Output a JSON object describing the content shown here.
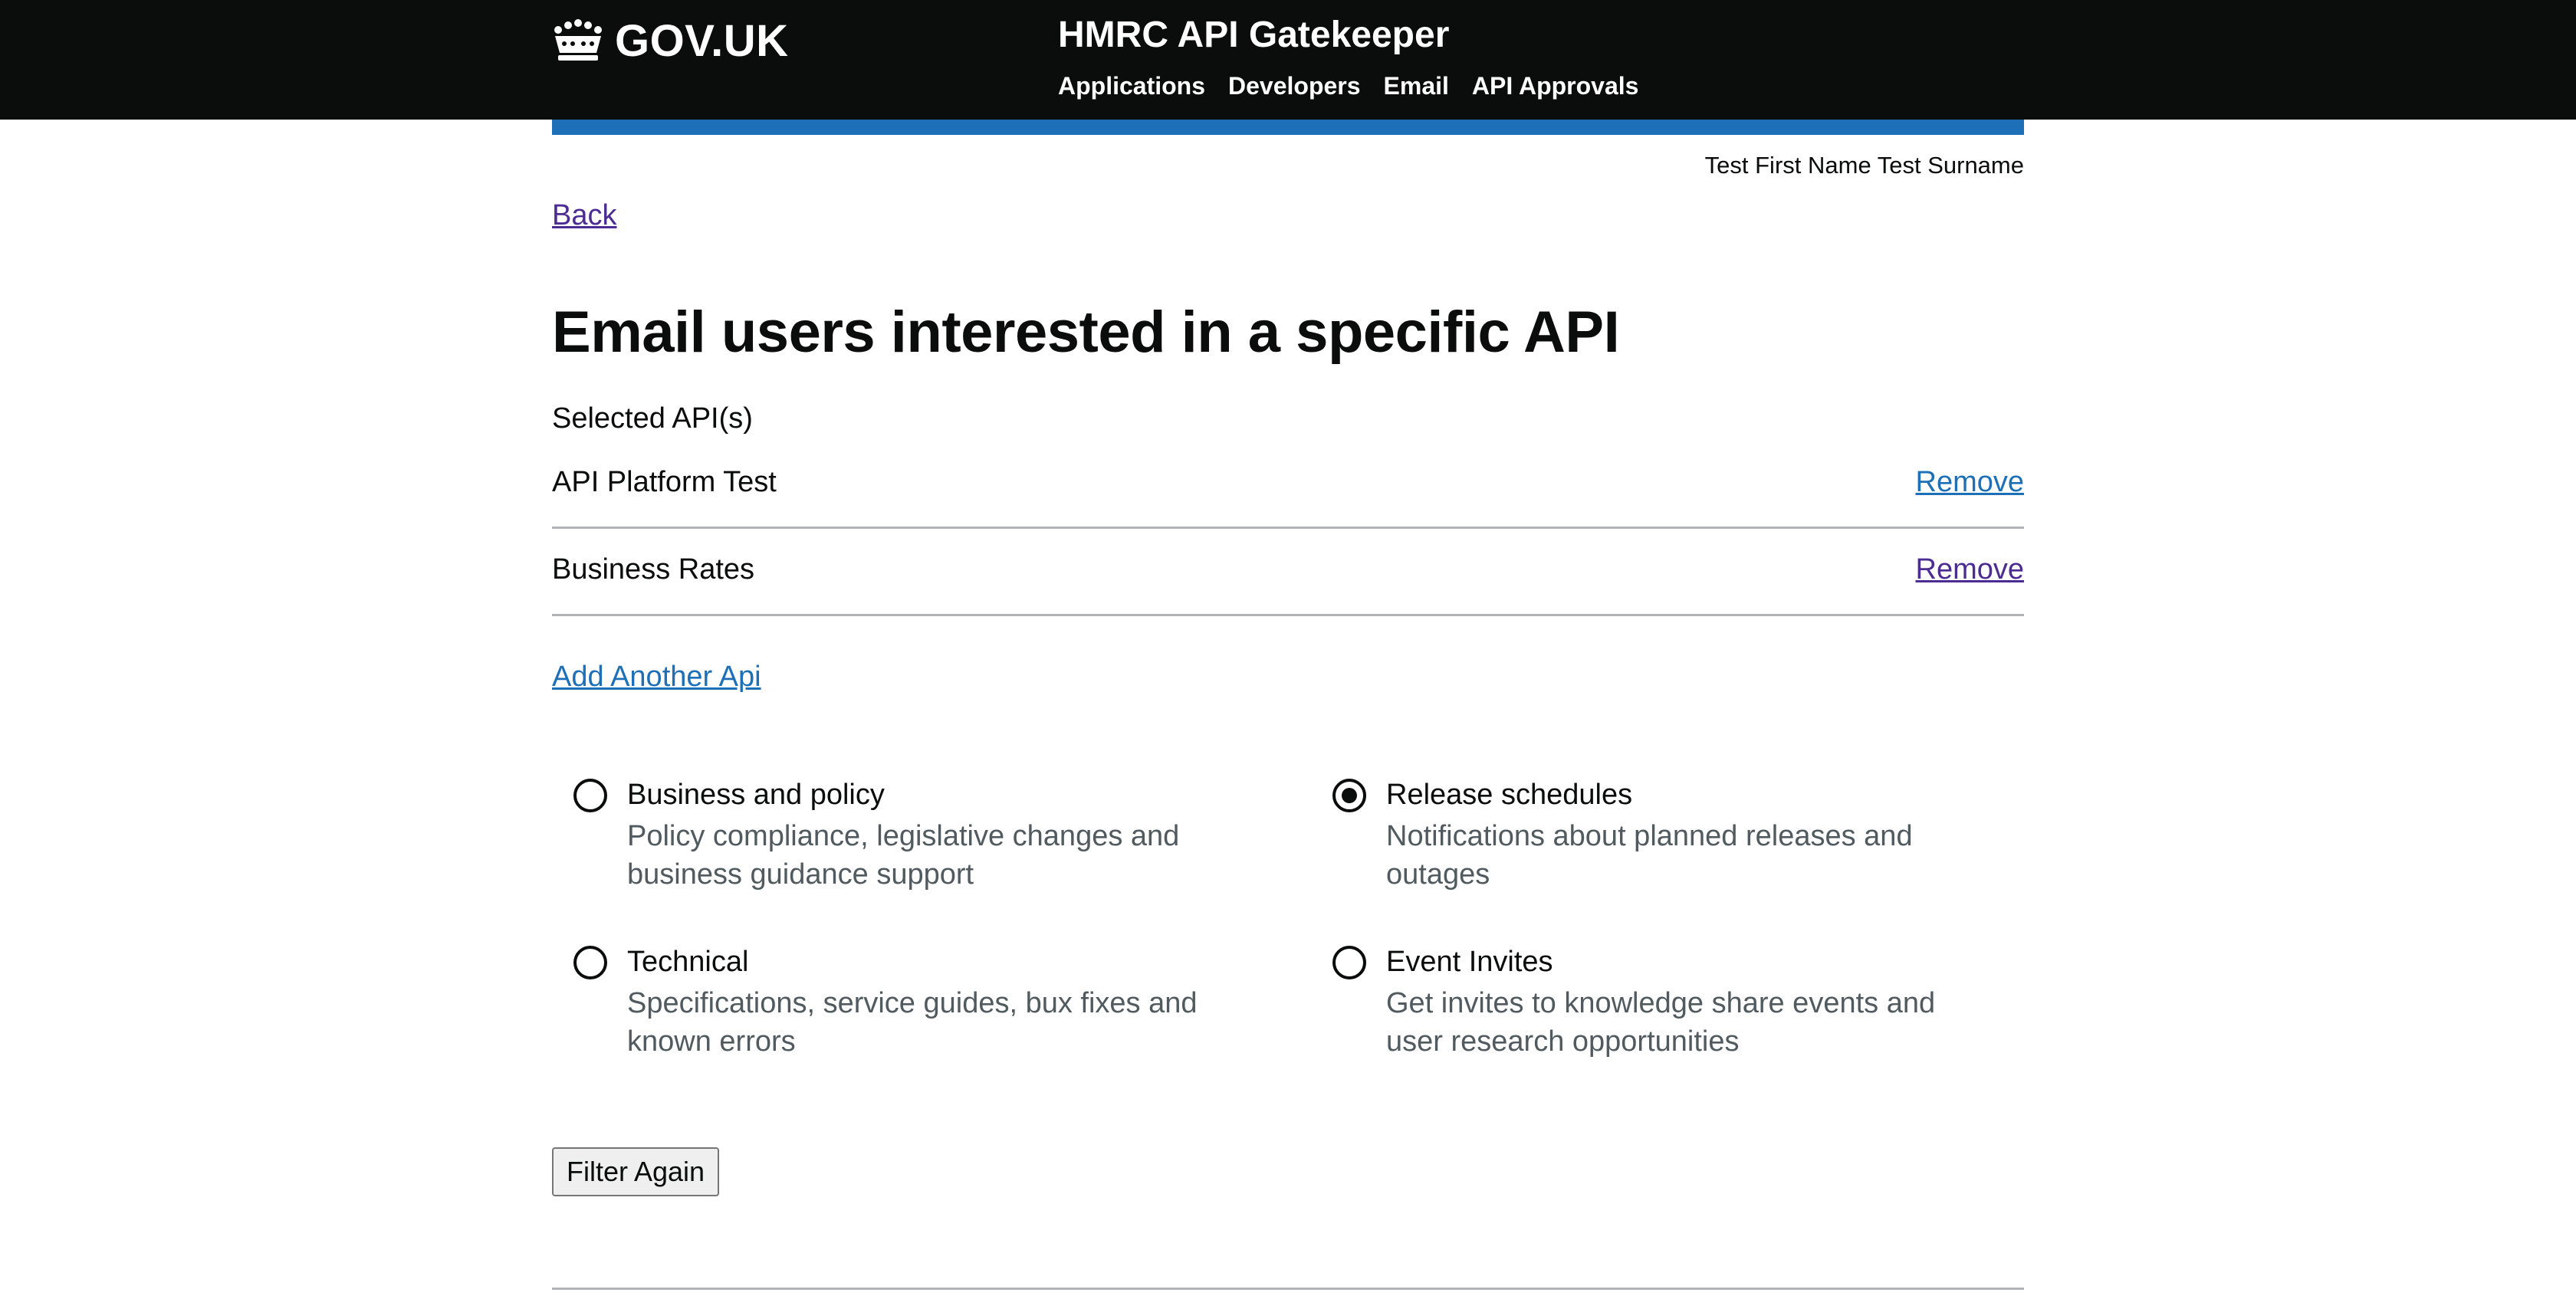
{
  "header": {
    "logo_text": "GOV.UK",
    "service_name": "HMRC API Gatekeeper",
    "nav": [
      "Applications",
      "Developers",
      "Email",
      "API Approvals"
    ]
  },
  "user": {
    "name": "Test First Name Test Surname"
  },
  "back_link": "Back",
  "page_title": "Email users interested in a specific API",
  "selected_apis": {
    "label": "Selected API(s)",
    "items": [
      {
        "name": "API Platform Test",
        "action": "Remove"
      },
      {
        "name": "Business Rates",
        "action": "Remove"
      }
    ]
  },
  "add_api_link": "Add Another Api",
  "topics": [
    {
      "label": "Business and policy",
      "hint": "Policy compliance, legislative changes and business guidance support",
      "checked": false
    },
    {
      "label": "Release schedules",
      "hint": "Notifications about planned releases and outages",
      "checked": true
    },
    {
      "label": "Technical",
      "hint": "Specifications, service guides, bux fixes and known errors",
      "checked": false
    },
    {
      "label": "Event Invites",
      "hint": "Get invites to knowledge share events and user research opportunities",
      "checked": false
    }
  ],
  "filter_button": "Filter Again",
  "colors": {
    "header_bg": "#0b0c0c",
    "accent_blue": "#1d70b8",
    "visited_link": "#4c2c92",
    "hint_text": "#505a5f"
  }
}
